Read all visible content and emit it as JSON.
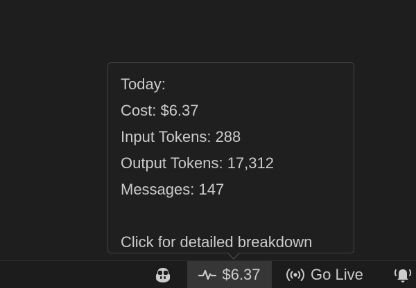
{
  "tooltip": {
    "heading": "Today:",
    "cost": "Cost: $6.37",
    "input_tokens": "Input Tokens: 288",
    "output_tokens": "Output Tokens: 17,312",
    "messages": "Messages: 147",
    "footer": "Click for detailed breakdown"
  },
  "statusbar": {
    "copilot_icon": "copilot-icon",
    "cost_icon": "pulse-icon",
    "cost_label": "$6.37",
    "golive_icon": "broadcast-icon",
    "golive_label": "Go Live",
    "bell_icon": "bell-icon"
  },
  "colors": {
    "background": "#1e1e1e",
    "statusbar": "#1c1c1c",
    "active_item": "#363636",
    "text": "#cccccc",
    "tooltip_border": "#454545"
  }
}
